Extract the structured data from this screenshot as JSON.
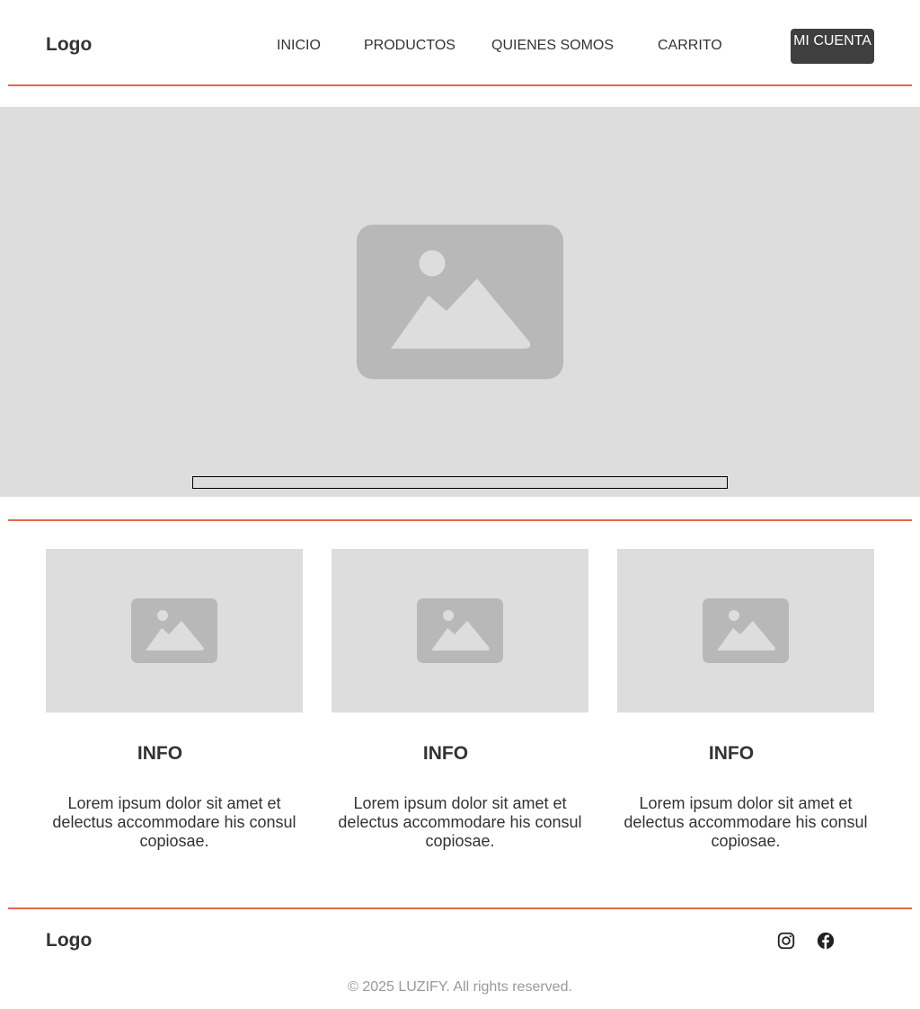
{
  "colors": {
    "accent": "#e8664a",
    "placeholder_bg": "#dddddd",
    "placeholder_icon": "#b8b8b8",
    "button_bg": "#3f3f3f"
  },
  "header": {
    "logo": "Logo",
    "nav": [
      "INICIO",
      "PRODUCTOS",
      "QUIENES SOMOS",
      "CARRITO"
    ],
    "account_button": "MI CUENTA"
  },
  "hero": {
    "image_icon": "image-placeholder-icon"
  },
  "cards": [
    {
      "title": "INFO",
      "text": "Lorem ipsum dolor sit amet et delectus accommodare his consul copiosae."
    },
    {
      "title": "INFO",
      "text": "Lorem ipsum dolor sit amet et delectus accommodare his consul copiosae."
    },
    {
      "title": "INFO",
      "text": "Lorem ipsum dolor sit amet et delectus accommodare his consul copiosae."
    }
  ],
  "footer": {
    "logo": "Logo",
    "social": [
      "instagram-icon",
      "facebook-icon"
    ],
    "copyright": "© 2025 LUZIFY. All rights reserved."
  }
}
